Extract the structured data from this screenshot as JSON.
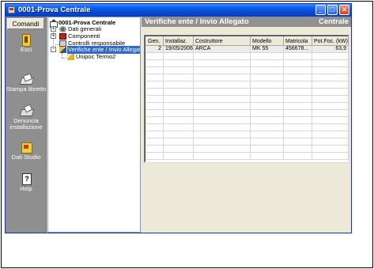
{
  "window": {
    "title": "0001-Prova Centrale"
  },
  "sidebar": {
    "header_label": "Comandi",
    "items": [
      {
        "label": "Esci",
        "icon": "exit-door-icon"
      },
      {
        "label": "Stampa libretto",
        "icon": "print-booklet-icon"
      },
      {
        "label": "Denuncia installazione",
        "icon": "report-installation-icon"
      },
      {
        "label": "Dati Studio",
        "icon": "studio-data-icon"
      },
      {
        "label": "Help",
        "icon": "help-icon"
      }
    ]
  },
  "tree": {
    "root": "0001-Prova Centrale",
    "nodes": [
      {
        "label": "Dati generali",
        "icon": "general-data-icon",
        "expander": "+"
      },
      {
        "label": "Componenti",
        "icon": "components-icon",
        "expander": "+"
      },
      {
        "label": "Controlli responsabile",
        "icon": "controls-icon",
        "expander": ""
      },
      {
        "label": "Verifiche ente / Invio Allegato",
        "icon": "verification-icon",
        "expander": "-"
      },
      {
        "label": "Unipoc Termo2",
        "icon": "unipoc-icon",
        "expander": ""
      }
    ]
  },
  "content": {
    "header_title": "Verifiche ente / Invio Allegato",
    "header_right": "Centrale"
  },
  "grid": {
    "columns": [
      "Gen.",
      "Installaz.",
      "Costruttore",
      "Modello",
      "Matricola",
      "Pot.Foc. (kW)"
    ],
    "rows": [
      [
        "2",
        "19/05/2006",
        "ARCA",
        "MK 55",
        "456678...",
        "63,9"
      ]
    ],
    "empty_rows": 15
  },
  "colors": {
    "titlebar": "#0846d4",
    "sidebar": "#8f8f8f",
    "selection": "#316ac5",
    "content_header": "#919191"
  }
}
